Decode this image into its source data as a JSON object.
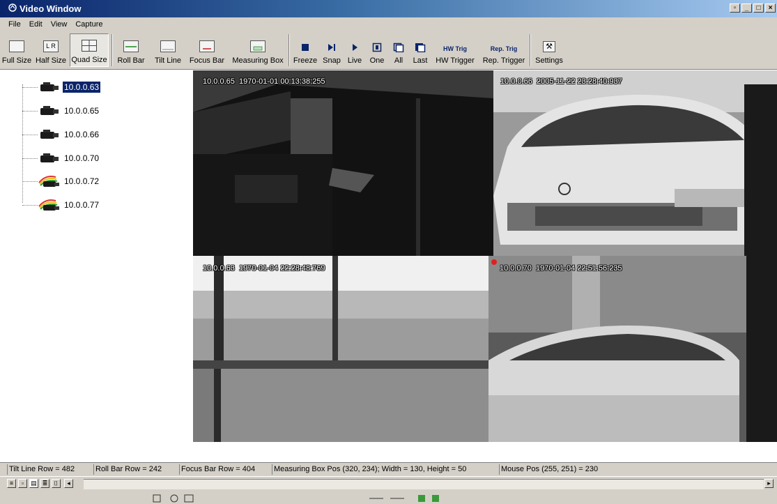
{
  "window": {
    "title": "Video Window"
  },
  "menu": [
    "File",
    "Edit",
    "View",
    "Capture"
  ],
  "toolbar": {
    "full_size": "Full Size",
    "half_size": "Half Size",
    "half_size_icon_text": "L R",
    "quad_size": "Quad Size",
    "roll_bar": "Roll Bar",
    "tilt_line": "Tilt Line",
    "focus_bar": "Focus Bar",
    "measuring_box": "Measuring Box",
    "freeze": "Freeze",
    "snap": "Snap",
    "live": "Live",
    "one": "One",
    "all": "All",
    "last": "Last",
    "hw_trigger": "HW Trigger",
    "hw_trigger_icon_text": "HW Trig",
    "rep_trigger": "Rep. Trigger",
    "rep_trigger_icon_text": "Rep. Trig",
    "settings": "Settings",
    "pressed": "Quad Size"
  },
  "tree": {
    "nodes": [
      {
        "label": "10.0.0.63",
        "icon": "camera-icon",
        "selected": true
      },
      {
        "label": "10.0.0.65",
        "icon": "camera-icon",
        "selected": false
      },
      {
        "label": "10.0.0.66",
        "icon": "camera-icon",
        "selected": false
      },
      {
        "label": "10.0.0.70",
        "icon": "camera-icon",
        "selected": false
      },
      {
        "label": "10.0.0.72",
        "icon": "color-camera-icon",
        "selected": false
      },
      {
        "label": "10.0.0.77",
        "icon": "color-camera-icon",
        "selected": false
      }
    ]
  },
  "video": {
    "panes": [
      {
        "camera": "10.0.0.65",
        "timestamp": "1970-01-01 00:13:38:255"
      },
      {
        "camera": "10.0.0.66",
        "timestamp": "2005-11-22 23:28:40:937"
      },
      {
        "camera": "10.0.0.63",
        "timestamp": "1970-01-04 22:28:48:769"
      },
      {
        "camera": "10.0.0.70",
        "timestamp": "1970-01-04 22:51:56:235",
        "recording": true
      }
    ]
  },
  "status": {
    "tilt_line": "Tilt Line Row = 482",
    "roll_bar": "Roll Bar Row = 242",
    "focus_bar": "Focus Bar Row = 404",
    "measuring_box": "Measuring Box Pos (320, 234); Width = 130, Height = 50",
    "mouse_pos": "Mouse Pos (255, 251) = 230"
  },
  "colors": {
    "title_gradient_start": "#0a246a",
    "selection": "#0a246a",
    "chrome": "#d4d0c8",
    "recording": "#e02020"
  }
}
